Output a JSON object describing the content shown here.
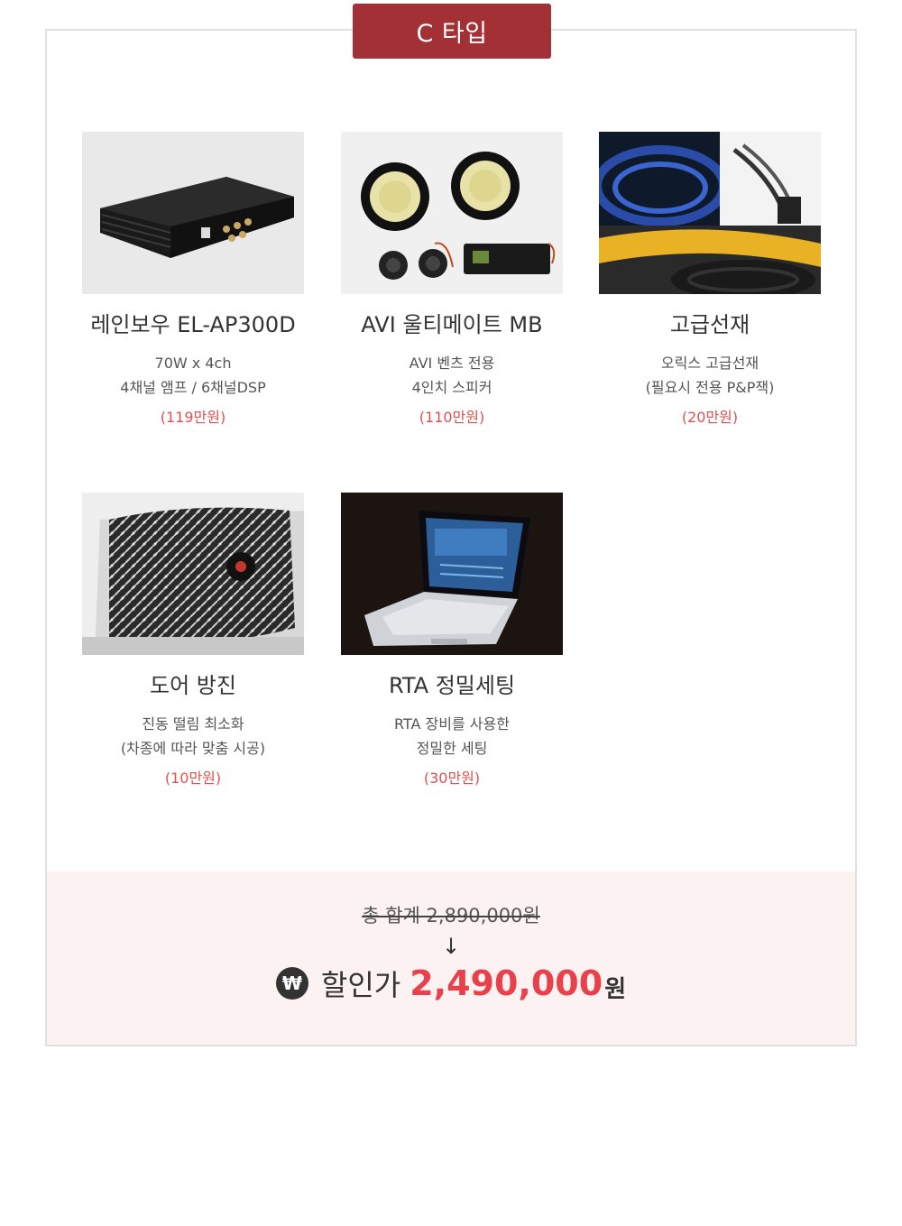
{
  "tag": "C 타입",
  "products": [
    {
      "title": "레인보우 EL-AP300D",
      "desc1": "70W x 4ch",
      "desc2": "4채널 앰프 / 6채널DSP",
      "price": "(119만원)"
    },
    {
      "title": "AVI 울티메이트 MB",
      "desc1": "AVI 벤츠 전용",
      "desc2": "4인치 스피커",
      "price": "(110만원)"
    },
    {
      "title": "고급선재",
      "desc1": "오릭스 고급선재",
      "desc2": "(필요시 전용 P&P잭)",
      "price": "(20만원)"
    },
    {
      "title": "도어 방진",
      "desc1": "진동 떨림 최소화",
      "desc2": "(차종에 따라 맞춤 시공)",
      "price": "(10만원)"
    },
    {
      "title": "RTA 정밀세팅",
      "desc1": "RTA 장비를 사용한",
      "desc2": "정밀한 세팅",
      "price": "(30만원)"
    }
  ],
  "summary": {
    "original_total": "총 합계 2,890,000원",
    "arrow": "↓",
    "won_symbol": "₩",
    "discount_label": "할인가",
    "discount_amount": "2,490,000",
    "discount_unit": "원"
  },
  "colors": {
    "tag_bg": "#a33034",
    "price": "#e05050",
    "amount": "#e8414b",
    "summary_bg": "#fdf2f2"
  }
}
